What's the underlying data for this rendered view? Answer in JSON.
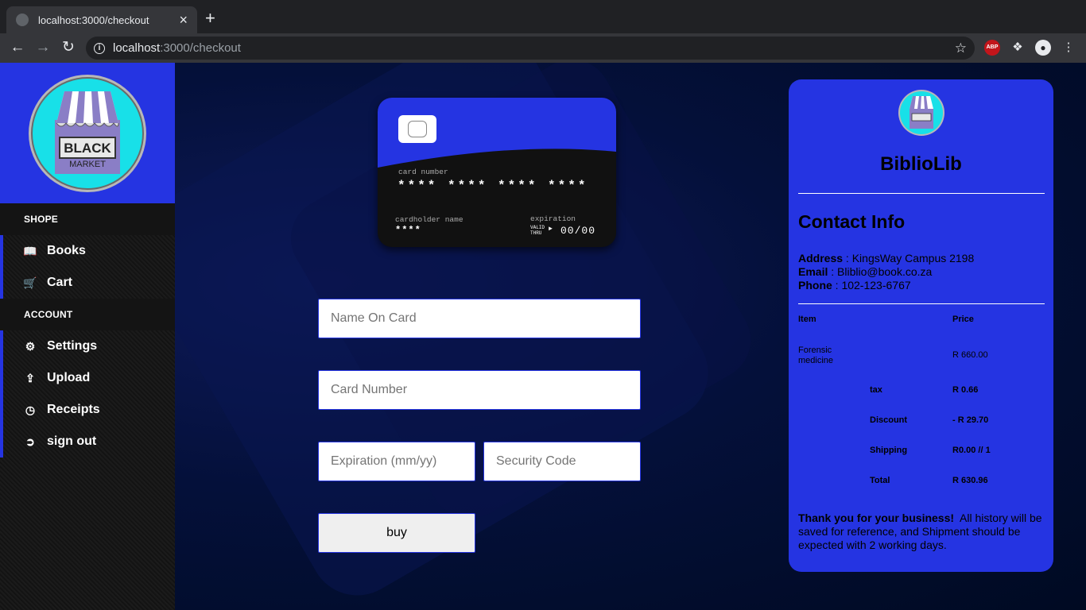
{
  "browser": {
    "tab_title": "localhost:3000/checkout",
    "new_tab": "+",
    "close_tab": "×",
    "url_host": "localhost",
    "url_path": ":3000/checkout",
    "abp": "ABP"
  },
  "sidebar": {
    "logo": {
      "line1": "BLACK",
      "line2": "MARKET"
    },
    "sections": [
      {
        "title": "SHOPE",
        "items": [
          {
            "label": "Books",
            "icon": "book-icon"
          },
          {
            "label": "Cart",
            "icon": "cart-icon"
          }
        ]
      },
      {
        "title": "ACCOUNT",
        "items": [
          {
            "label": "Settings",
            "icon": "gears-icon"
          },
          {
            "label": "Upload",
            "icon": "upload-icon"
          },
          {
            "label": "Receipts",
            "icon": "clock-icon"
          },
          {
            "label": "sign out",
            "icon": "sign-out-icon"
          }
        ]
      }
    ]
  },
  "card": {
    "number_label": "card number",
    "number": "**** **** **** ****",
    "holder_label": "cardholder name",
    "holder": "****",
    "expiration_label": "expiration",
    "valid_thru": "VALID THRU",
    "expiration": "00/00"
  },
  "form": {
    "name_placeholder": "Name On Card",
    "number_placeholder": "Card Number",
    "expiration_placeholder": "Expiration (mm/yy)",
    "security_placeholder": "Security Code",
    "buy_label": "buy"
  },
  "receipt": {
    "brand": "BiblioLib",
    "contact_title": "Contact Info",
    "address_label": "Address",
    "address": "KingsWay Campus 2198",
    "email_label": "Email",
    "email": "Bliblio@book.co.za",
    "phone_label": "Phone",
    "phone": "102-123-6767",
    "col_item": "Item",
    "col_price": "Price",
    "item_name_1": "Forensic",
    "item_name_2": "medicine",
    "item_price": "R 660.00",
    "tax_label": "tax",
    "tax": "R 0.66",
    "discount_label": "Discount",
    "discount": "- R 29.70",
    "shipping_label": "Shipping",
    "shipping": "R0.00 // 1",
    "total_label": "Total",
    "total": "R 630.96",
    "thanks_bold": "Thank you for your business!",
    "thanks_text": "All history will be saved for reference, and Shipment should be expected with 2 working days."
  },
  "colors": {
    "accent": "#2534e2",
    "sidebar_bg": "#141414",
    "page_bg": "#000a22"
  }
}
